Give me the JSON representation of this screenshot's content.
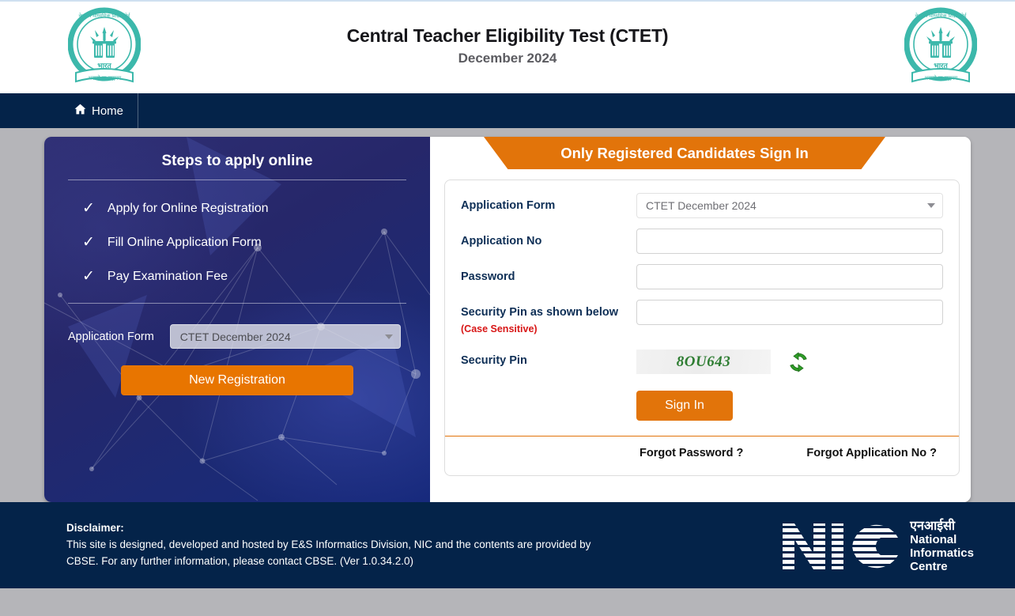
{
  "header": {
    "title": "Central Teacher Eligibility Test (CTET)",
    "subtitle": "December 2024",
    "logo_left_name": "cbse-emblem-left",
    "logo_right_name": "cbse-emblem-right",
    "emblem": {
      "top_text": "केन्द्रीय माध्यमिक शिक्षा बोर्ड",
      "mid_text": "भारत",
      "ribbon_text": "असतो मा सद्गमय",
      "color": "#3cb8ab"
    }
  },
  "nav": {
    "home_label": "Home",
    "home_icon": "home-icon"
  },
  "left_panel": {
    "heading": "Steps to apply online",
    "steps": [
      {
        "check": "✓",
        "label": "Apply for Online Registration"
      },
      {
        "check": "✓",
        "label": "Fill Online Application Form"
      },
      {
        "check": "✓",
        "label": "Pay Examination Fee"
      }
    ],
    "application_form_label": "Application Form",
    "application_form_value": "CTET December 2024",
    "new_registration_label": "New Registration"
  },
  "signin": {
    "banner": "Only Registered Candidates Sign In",
    "fields": {
      "application_form_label": "Application Form",
      "application_form_value": "CTET December 2024",
      "application_no_label": "Application No",
      "application_no_value": "",
      "application_no_placeholder": "",
      "password_label": "Password",
      "password_value": "",
      "password_placeholder": "",
      "security_pin_input_label": "Security Pin as shown below",
      "case_sensitive_note": "(Case Sensitive)",
      "security_pin_value": "",
      "security_pin_placeholder": "",
      "captcha_label": "Security Pin",
      "captcha_text": "8OU643",
      "refresh_icon": "refresh-icon"
    },
    "signin_button": "Sign In",
    "forgot_password": "Forgot Password ?",
    "forgot_application_no": "Forgot Application No ?"
  },
  "footer": {
    "disclaimer_title": "Disclaimer:",
    "disclaimer_line1": "This site is designed, developed and hosted by E&S Informatics Division, NIC and the contents are provided by",
    "disclaimer_line2": "CBSE. For any further information, please contact CBSE. (Ver 1.0.34.2.0)",
    "nic": {
      "mark": "NIC",
      "hindi": "एनआईसी",
      "line1": "National",
      "line2": "Informatics",
      "line3": "Centre"
    }
  },
  "colors": {
    "navy": "#042349",
    "orange": "#e2740a",
    "panel_blue": "#26276a",
    "page_bg": "#b5b5b9",
    "captcha_green": "#2e7d32",
    "red_note": "#d81616"
  }
}
